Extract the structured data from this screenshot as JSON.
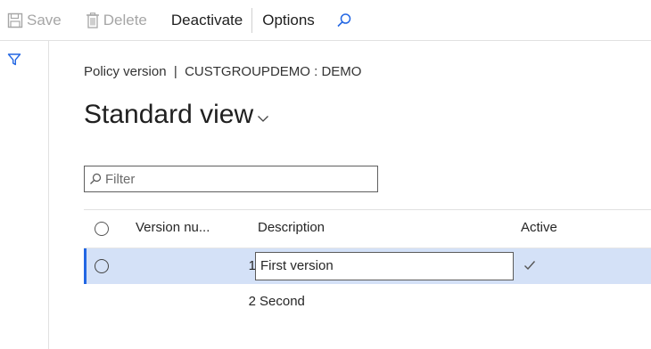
{
  "toolbar": {
    "save_label": "Save",
    "delete_label": "Delete",
    "deactivate_label": "Deactivate",
    "options_label": "Options"
  },
  "page": {
    "breadcrumb": "Policy version  |  CUSTGROUPDEMO : DEMO",
    "view_name": "Standard view"
  },
  "filter": {
    "placeholder": "Filter",
    "value": ""
  },
  "grid": {
    "columns": {
      "version_number": "Version nu...",
      "description": "Description",
      "active": "Active"
    },
    "rows": [
      {
        "version_number": "1",
        "description": "First version",
        "active": true,
        "selected": true
      },
      {
        "version_number": "2",
        "description": "Second",
        "active": false,
        "selected": false
      }
    ]
  },
  "colors": {
    "accent": "#2266e3",
    "selected_row": "#d4e1f7",
    "disabled_text": "#a6a6a6"
  },
  "icons": [
    "save-icon",
    "delete-icon",
    "search-icon",
    "filter-icon",
    "chevron-down-icon",
    "checkmark-icon"
  ]
}
